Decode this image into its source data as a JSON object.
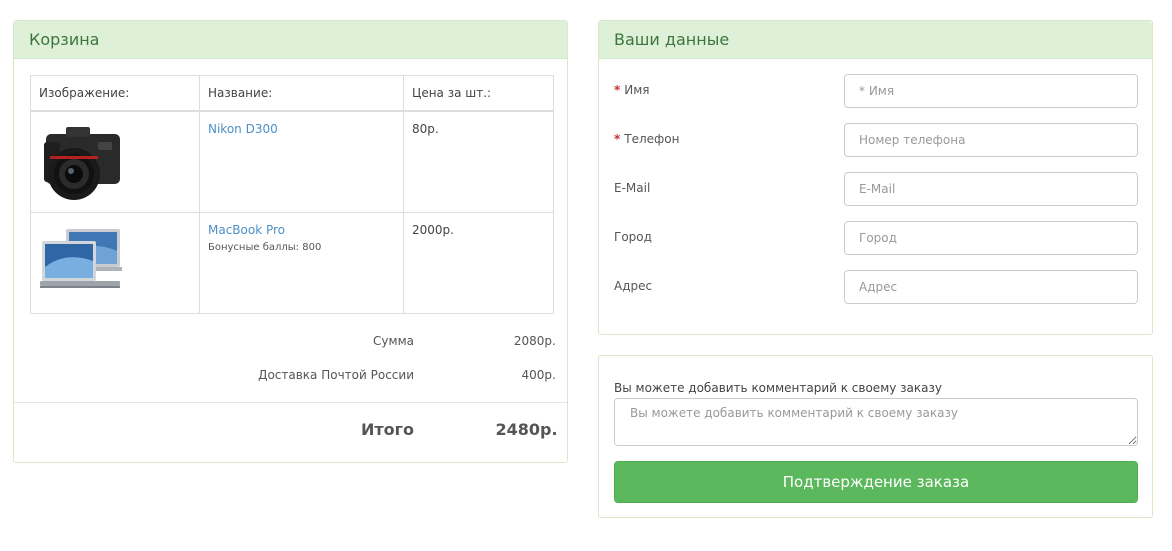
{
  "cart": {
    "title": "Корзина",
    "columns": [
      "Изображение:",
      "Название:",
      "Цена за шт.:"
    ],
    "items": [
      {
        "image": "camera-image",
        "name": "Nikon D300",
        "bonus": "",
        "price": "80р."
      },
      {
        "image": "laptop-image",
        "name": "MacBook Pro",
        "bonus": "Бонусные баллы: 800",
        "price": "2000р."
      }
    ],
    "totals": [
      {
        "label": "Сумма",
        "value": "2080р."
      },
      {
        "label": "Доставка Почтой России",
        "value": "400р."
      }
    ],
    "grand_total": {
      "label": "Итого",
      "value": "2480р."
    }
  },
  "customer": {
    "title": "Ваши данные",
    "fields": [
      {
        "label": "Имя",
        "required": true,
        "placeholder": "* Имя"
      },
      {
        "label": "Телефон",
        "required": true,
        "placeholder": "Номер телефона"
      },
      {
        "label": "E-Mail",
        "required": false,
        "placeholder": "E-Mail"
      },
      {
        "label": "Город",
        "required": false,
        "placeholder": "Город"
      },
      {
        "label": "Адрес",
        "required": false,
        "placeholder": "Адрес"
      }
    ]
  },
  "comment": {
    "label": "Вы можете добавить комментарий к своему заказу",
    "placeholder": "Вы можете добавить комментарий к своему заказу",
    "confirm_label": "Подтверждение заказа"
  },
  "colors": {
    "heading_bg": "#dff0d8",
    "heading_text": "#3c763d",
    "link": "#4d8fc7",
    "button": "#5cb85c",
    "required": "#c9302c"
  }
}
